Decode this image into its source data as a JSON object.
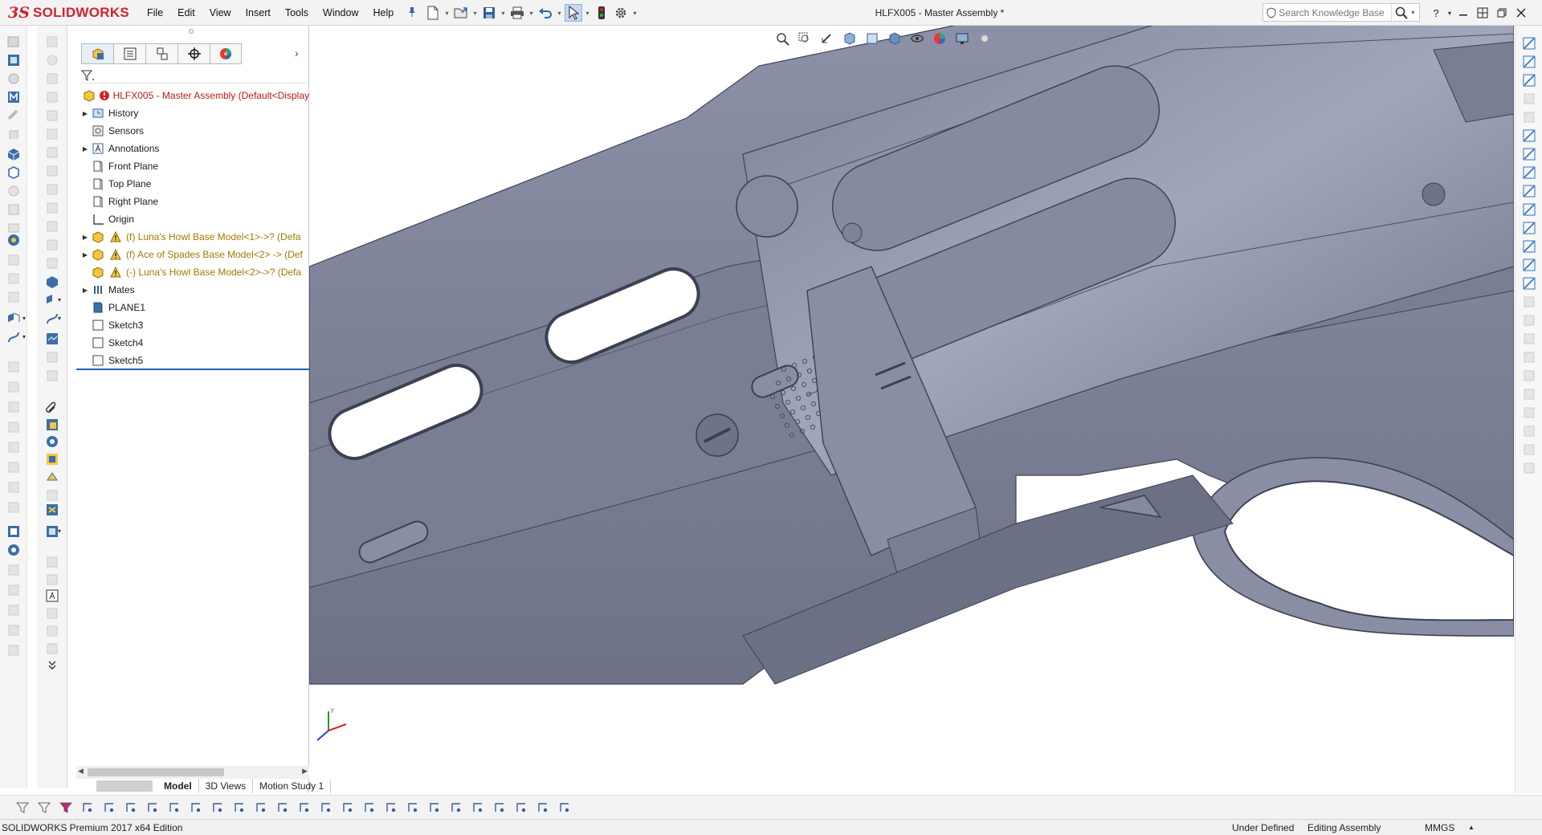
{
  "app": {
    "brand_ds": "3S",
    "brand_name": "SOLIDWORKS",
    "window_title": "HLFX005 - Master Assembly *"
  },
  "menu": [
    "File",
    "Edit",
    "View",
    "Insert",
    "Tools",
    "Window",
    "Help"
  ],
  "search": {
    "placeholder": "Search Knowledge Base"
  },
  "feature_tree": {
    "tabs": [
      "featuremanager-icon",
      "propertymanager-icon",
      "configurationmanager-icon",
      "dimxpert-icon",
      "display-manager-icon"
    ],
    "items": [
      {
        "label": "HLFX005 - Master Assembly  (Default<Display",
        "icon": "assembly-icon",
        "expand": "",
        "style": "red"
      },
      {
        "label": "History",
        "icon": "history-icon",
        "expand": "▶",
        "style": ""
      },
      {
        "label": "Sensors",
        "icon": "sensors-icon",
        "expand": "",
        "style": ""
      },
      {
        "label": "Annotations",
        "icon": "annotations-icon",
        "expand": "▶",
        "style": ""
      },
      {
        "label": "Front Plane",
        "icon": "plane-icon",
        "expand": "",
        "style": ""
      },
      {
        "label": "Top Plane",
        "icon": "plane-icon",
        "expand": "",
        "style": ""
      },
      {
        "label": "Right Plane",
        "icon": "plane-icon",
        "expand": "",
        "style": ""
      },
      {
        "label": "Origin",
        "icon": "origin-icon",
        "expand": "",
        "style": ""
      },
      {
        "label": "(f) Luna's Howl Base Model<1>->? (Defa",
        "icon": "part-warning-icon",
        "expand": "▶",
        "style": "warn"
      },
      {
        "label": "(f) Ace of Spades Base Model<2> -> (Def",
        "icon": "part-warning-icon",
        "expand": "▶",
        "style": "warn"
      },
      {
        "label": "(-) Luna's Howl Base Model<2>->? (Defa",
        "icon": "part-warning-icon",
        "expand": "",
        "style": "warn"
      },
      {
        "label": "Mates",
        "icon": "mates-icon",
        "expand": "▶",
        "style": ""
      },
      {
        "label": "PLANE1",
        "icon": "plane-solid-icon",
        "expand": "",
        "style": ""
      },
      {
        "label": "Sketch3",
        "icon": "sketch-icon",
        "expand": "",
        "style": ""
      },
      {
        "label": "Sketch4",
        "icon": "sketch-icon",
        "expand": "",
        "style": ""
      },
      {
        "label": "Sketch5",
        "icon": "sketch-icon",
        "expand": "",
        "style": ""
      }
    ]
  },
  "bottom_tabs": [
    "Model",
    "3D Views",
    "Motion Study 1"
  ],
  "status": {
    "edition": "SOLIDWORKS Premium 2017 x64 Edition",
    "state": "Under Defined",
    "mode": "Editing Assembly",
    "units": "MMGS"
  },
  "colors": {
    "model_face": "#7f8399",
    "model_light": "#9da1b6",
    "model_dark": "#55586a",
    "brand_red": "#d2232a",
    "accent_blue": "#1f5fbf"
  }
}
